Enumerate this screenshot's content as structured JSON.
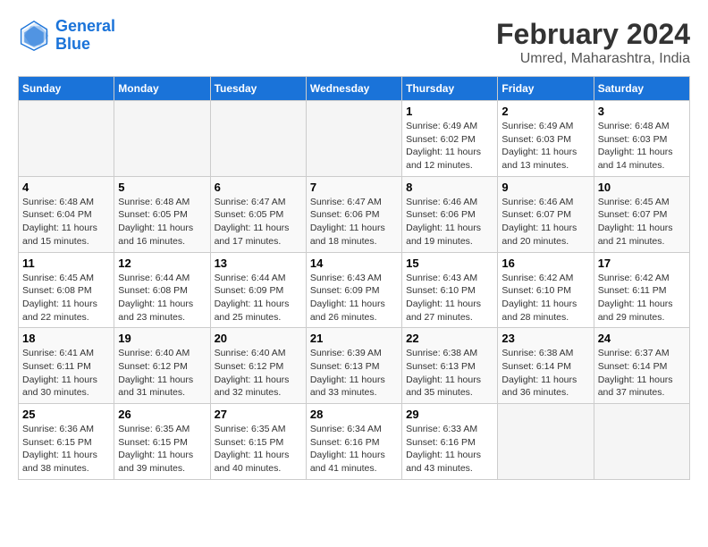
{
  "header": {
    "logo_line1": "General",
    "logo_line2": "Blue",
    "title": "February 2024",
    "subtitle": "Umred, Maharashtra, India"
  },
  "weekdays": [
    "Sunday",
    "Monday",
    "Tuesday",
    "Wednesday",
    "Thursday",
    "Friday",
    "Saturday"
  ],
  "weeks": [
    [
      {
        "day": "",
        "info": ""
      },
      {
        "day": "",
        "info": ""
      },
      {
        "day": "",
        "info": ""
      },
      {
        "day": "",
        "info": ""
      },
      {
        "day": "1",
        "info": "Sunrise: 6:49 AM\nSunset: 6:02 PM\nDaylight: 11 hours\nand 12 minutes."
      },
      {
        "day": "2",
        "info": "Sunrise: 6:49 AM\nSunset: 6:03 PM\nDaylight: 11 hours\nand 13 minutes."
      },
      {
        "day": "3",
        "info": "Sunrise: 6:48 AM\nSunset: 6:03 PM\nDaylight: 11 hours\nand 14 minutes."
      }
    ],
    [
      {
        "day": "4",
        "info": "Sunrise: 6:48 AM\nSunset: 6:04 PM\nDaylight: 11 hours\nand 15 minutes."
      },
      {
        "day": "5",
        "info": "Sunrise: 6:48 AM\nSunset: 6:05 PM\nDaylight: 11 hours\nand 16 minutes."
      },
      {
        "day": "6",
        "info": "Sunrise: 6:47 AM\nSunset: 6:05 PM\nDaylight: 11 hours\nand 17 minutes."
      },
      {
        "day": "7",
        "info": "Sunrise: 6:47 AM\nSunset: 6:06 PM\nDaylight: 11 hours\nand 18 minutes."
      },
      {
        "day": "8",
        "info": "Sunrise: 6:46 AM\nSunset: 6:06 PM\nDaylight: 11 hours\nand 19 minutes."
      },
      {
        "day": "9",
        "info": "Sunrise: 6:46 AM\nSunset: 6:07 PM\nDaylight: 11 hours\nand 20 minutes."
      },
      {
        "day": "10",
        "info": "Sunrise: 6:45 AM\nSunset: 6:07 PM\nDaylight: 11 hours\nand 21 minutes."
      }
    ],
    [
      {
        "day": "11",
        "info": "Sunrise: 6:45 AM\nSunset: 6:08 PM\nDaylight: 11 hours\nand 22 minutes."
      },
      {
        "day": "12",
        "info": "Sunrise: 6:44 AM\nSunset: 6:08 PM\nDaylight: 11 hours\nand 23 minutes."
      },
      {
        "day": "13",
        "info": "Sunrise: 6:44 AM\nSunset: 6:09 PM\nDaylight: 11 hours\nand 25 minutes."
      },
      {
        "day": "14",
        "info": "Sunrise: 6:43 AM\nSunset: 6:09 PM\nDaylight: 11 hours\nand 26 minutes."
      },
      {
        "day": "15",
        "info": "Sunrise: 6:43 AM\nSunset: 6:10 PM\nDaylight: 11 hours\nand 27 minutes."
      },
      {
        "day": "16",
        "info": "Sunrise: 6:42 AM\nSunset: 6:10 PM\nDaylight: 11 hours\nand 28 minutes."
      },
      {
        "day": "17",
        "info": "Sunrise: 6:42 AM\nSunset: 6:11 PM\nDaylight: 11 hours\nand 29 minutes."
      }
    ],
    [
      {
        "day": "18",
        "info": "Sunrise: 6:41 AM\nSunset: 6:11 PM\nDaylight: 11 hours\nand 30 minutes."
      },
      {
        "day": "19",
        "info": "Sunrise: 6:40 AM\nSunset: 6:12 PM\nDaylight: 11 hours\nand 31 minutes."
      },
      {
        "day": "20",
        "info": "Sunrise: 6:40 AM\nSunset: 6:12 PM\nDaylight: 11 hours\nand 32 minutes."
      },
      {
        "day": "21",
        "info": "Sunrise: 6:39 AM\nSunset: 6:13 PM\nDaylight: 11 hours\nand 33 minutes."
      },
      {
        "day": "22",
        "info": "Sunrise: 6:38 AM\nSunset: 6:13 PM\nDaylight: 11 hours\nand 35 minutes."
      },
      {
        "day": "23",
        "info": "Sunrise: 6:38 AM\nSunset: 6:14 PM\nDaylight: 11 hours\nand 36 minutes."
      },
      {
        "day": "24",
        "info": "Sunrise: 6:37 AM\nSunset: 6:14 PM\nDaylight: 11 hours\nand 37 minutes."
      }
    ],
    [
      {
        "day": "25",
        "info": "Sunrise: 6:36 AM\nSunset: 6:15 PM\nDaylight: 11 hours\nand 38 minutes."
      },
      {
        "day": "26",
        "info": "Sunrise: 6:35 AM\nSunset: 6:15 PM\nDaylight: 11 hours\nand 39 minutes."
      },
      {
        "day": "27",
        "info": "Sunrise: 6:35 AM\nSunset: 6:15 PM\nDaylight: 11 hours\nand 40 minutes."
      },
      {
        "day": "28",
        "info": "Sunrise: 6:34 AM\nSunset: 6:16 PM\nDaylight: 11 hours\nand 41 minutes."
      },
      {
        "day": "29",
        "info": "Sunrise: 6:33 AM\nSunset: 6:16 PM\nDaylight: 11 hours\nand 43 minutes."
      },
      {
        "day": "",
        "info": ""
      },
      {
        "day": "",
        "info": ""
      }
    ]
  ]
}
